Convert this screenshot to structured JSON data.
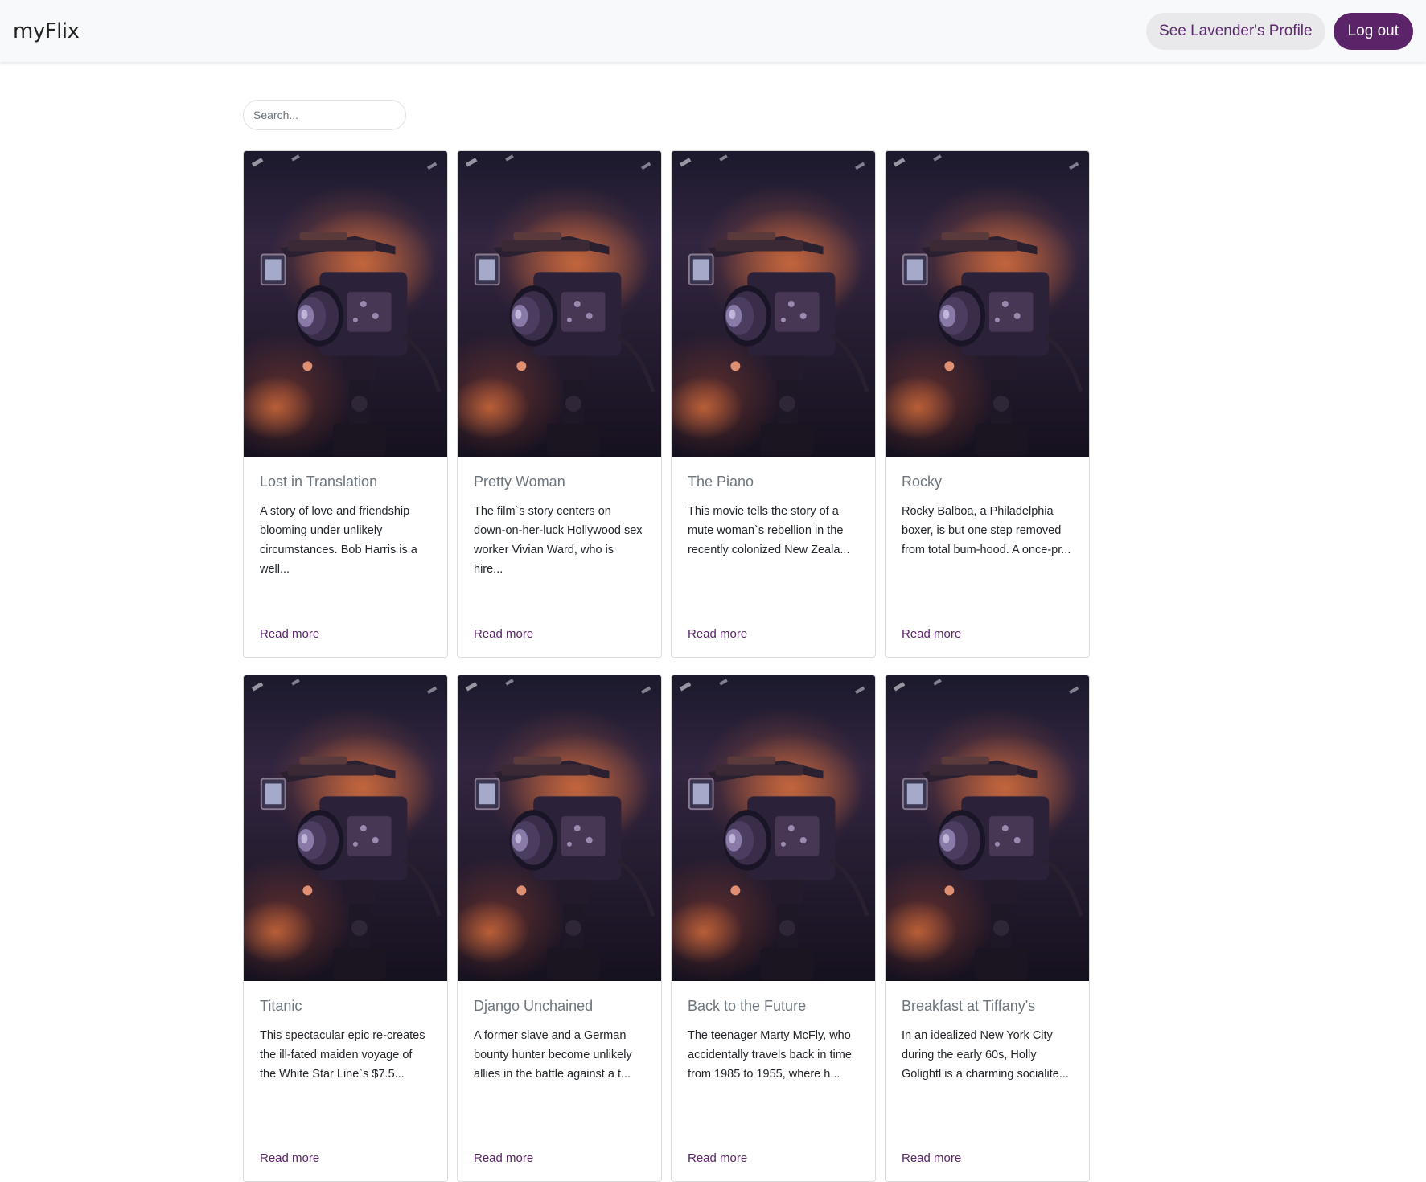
{
  "navbar": {
    "brand": "myFlix",
    "profile_label": "See Lavender's Profile",
    "logout_label": "Log out"
  },
  "search": {
    "placeholder": "Search...",
    "value": ""
  },
  "movies": [
    {
      "title": "Lost in Translation",
      "description": "A story of love and friendship blooming under unlikely circumstances. Bob Harris is a well...",
      "link": "Read more"
    },
    {
      "title": "Pretty Woman",
      "description": "The film`s story centers on down-on-her-luck Hollywood sex worker Vivian Ward, who is hire...",
      "link": "Read more"
    },
    {
      "title": "The Piano",
      "description": "This movie tells the story of a mute woman`s rebellion in the recently colonized New Zeala...",
      "link": "Read more"
    },
    {
      "title": "Rocky",
      "description": "Rocky Balboa, a Philadelphia boxer, is but one step removed from total bum-hood. A once-pr...",
      "link": "Read more"
    },
    {
      "title": "Titanic",
      "description": "This spectacular epic re-creates the ill-fated maiden voyage of the White Star Line`s $7.5...",
      "link": "Read more"
    },
    {
      "title": "Django Unchained",
      "description": "A former slave and a German bounty hunter become unlikely allies in the battle against a t...",
      "link": "Read more"
    },
    {
      "title": "Back to the Future",
      "description": "The teenager Marty McFly, who accidentally travels back in time from 1985 to 1955, where h...",
      "link": "Read more"
    },
    {
      "title": "Breakfast at Tiffany's",
      "description": "In an idealized New York City during the early 60s, Holly Golightl is a charming socialite...",
      "link": "Read more"
    }
  ],
  "colors": {
    "accent": "#5b2468",
    "navbar_bg": "#f8f9fa",
    "profile_btn_bg": "#e9e9ec"
  },
  "card_image_icon": "camera-photo"
}
